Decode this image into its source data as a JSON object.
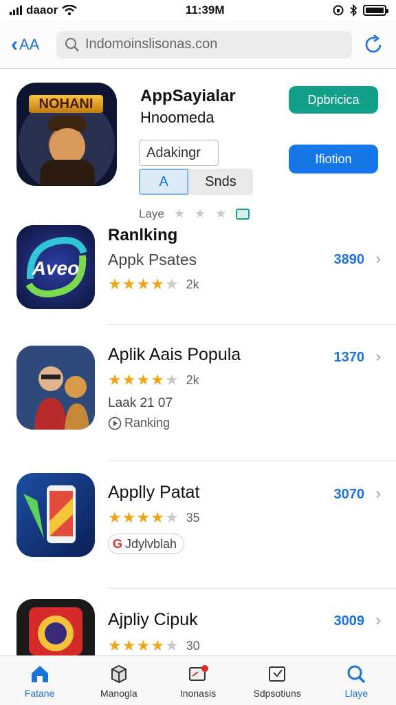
{
  "status": {
    "carrier": "daaor",
    "time": "11:39M"
  },
  "nav": {
    "back_label": "AA",
    "search_text": "Indomoinslisonas.con"
  },
  "hero": {
    "icon_banner": "NOHANI",
    "title": "AppSayialar",
    "subtitle": "Hnoomeda",
    "primary_button": "Dpbricica",
    "secondary_button": "Ifiotion",
    "field_value": "Adakingr",
    "segment_a": "A",
    "segment_b": "Snds",
    "rating_label": "Laye"
  },
  "items": [
    {
      "title": "Ranlking",
      "subtitle": "Appk Psates",
      "count": "2k",
      "price": "3890",
      "icon_text": "Aveo"
    },
    {
      "title": "Aplik Aais Popula",
      "count": "2k",
      "meta": "Laak 21 07",
      "tag": "Ranking",
      "price": "1370"
    },
    {
      "title": "Applly Patat",
      "count": "35",
      "tag": "Jdylvblah",
      "price": "3070"
    },
    {
      "title": "Ajpliy Cipuk",
      "count": "30",
      "price": "3009"
    }
  ],
  "tabs": [
    {
      "label": "Fatane",
      "icon": "home-icon"
    },
    {
      "label": "Manogla",
      "icon": "box-icon"
    },
    {
      "label": "Inonasis",
      "icon": "message-icon"
    },
    {
      "label": "Sdpsotiuns",
      "icon": "download-icon"
    },
    {
      "label": "Llaye",
      "icon": "search-icon"
    }
  ],
  "colors": {
    "accent": "#1a73d9",
    "teal": "#12a08a",
    "star": "#f1a417"
  }
}
